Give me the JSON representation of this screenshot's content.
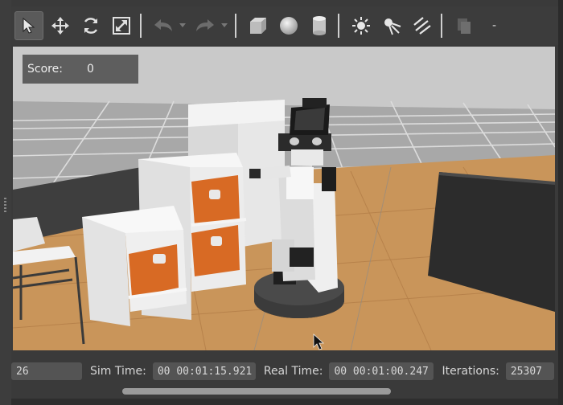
{
  "toolbar": {
    "tools": [
      {
        "name": "select-mode",
        "icon": "cursor-arrow-icon"
      },
      {
        "name": "translate-mode",
        "icon": "move-cross-icon"
      },
      {
        "name": "rotate-mode",
        "icon": "rotate-icon"
      },
      {
        "name": "scale-mode",
        "icon": "scale-icon"
      },
      {
        "name": "undo",
        "icon": "undo-icon"
      },
      {
        "name": "redo",
        "icon": "redo-icon"
      },
      {
        "name": "box-shape",
        "icon": "box-icon"
      },
      {
        "name": "sphere-shape",
        "icon": "sphere-icon"
      },
      {
        "name": "cylinder-shape",
        "icon": "cylinder-icon"
      },
      {
        "name": "point-light",
        "icon": "point-light-icon"
      },
      {
        "name": "spot-light",
        "icon": "spot-light-icon"
      },
      {
        "name": "directional-light",
        "icon": "directional-light-icon"
      },
      {
        "name": "copy",
        "icon": "copy-icon"
      }
    ],
    "more_label": "-"
  },
  "overlay": {
    "score_label": "Score:",
    "score_value": "0"
  },
  "statusbar": {
    "rtf_value": "26",
    "sim_time_label": "Sim Time:",
    "sim_time_value": "00 00:01:15.921",
    "real_time_label": "Real Time:",
    "real_time_value": "00 00:01:00.247",
    "iterations_label": "Iterations:",
    "iterations_value": "25307"
  },
  "colors": {
    "floor": "#c9955a",
    "grid_ground": "#c7c7c7",
    "storage_bin": "#d86a24",
    "shelf": "#f0f0f0",
    "robot_body": "#efefef",
    "robot_base": "#3b3b3b",
    "table": "#2c2c2c"
  }
}
